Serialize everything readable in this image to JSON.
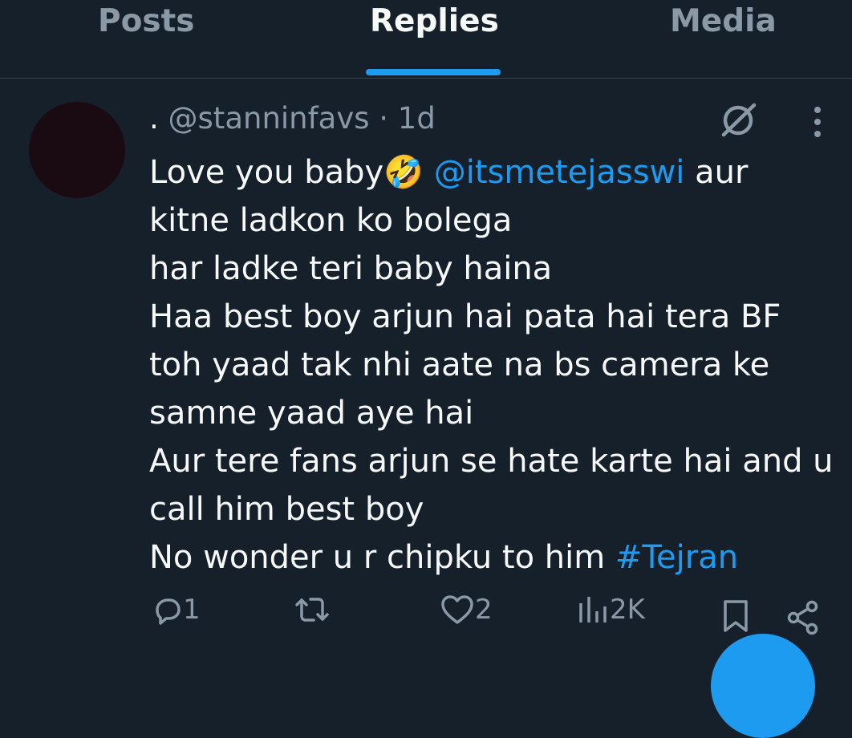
{
  "tabs": {
    "posts": "Posts",
    "replies": "Replies",
    "media": "Media"
  },
  "tweet": {
    "display_name": ".",
    "handle": "@stanninfavs",
    "separator": "·",
    "time": "1d",
    "lines": [
      {
        "text": "Love you baby",
        "emoji": "🤣",
        "mention": "@itsmetejasswi",
        "after": " aur"
      },
      {
        "text": "kitne ladkon ko bolega"
      },
      {
        "text": "har ladke teri baby haina"
      },
      {
        "text": "Haa best boy arjun hai pata hai tera BF"
      },
      {
        "text": "toh yaad tak nhi aate na bs camera ke"
      },
      {
        "text": "samne yaad aye hai"
      },
      {
        "text": "Aur tere fans arjun se hate karte hai and u"
      },
      {
        "text": "call him best boy"
      },
      {
        "text": "No wonder u r chipku to him ",
        "hashtag": "#Tejran"
      }
    ]
  },
  "actions": {
    "replies": "1",
    "reposts": "",
    "likes": "2",
    "views": "2K"
  },
  "colors": {
    "background": "#15202b",
    "accent": "#1d9bf0",
    "muted": "#8b98a5",
    "text": "#f7f9f9"
  }
}
